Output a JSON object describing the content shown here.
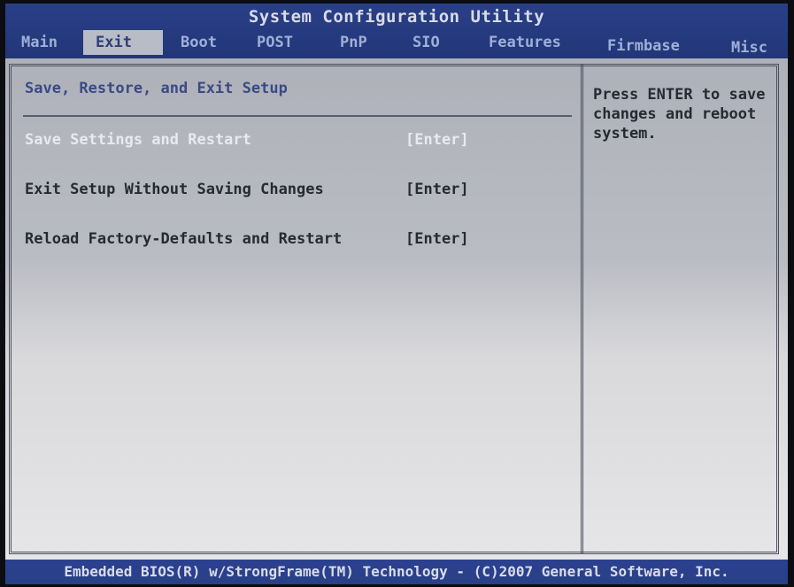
{
  "app": {
    "title": "System Configuration Utility"
  },
  "tabs": [
    {
      "label": "Main"
    },
    {
      "label": "Exit",
      "active": true
    },
    {
      "label": "Boot"
    },
    {
      "label": "POST"
    },
    {
      "label": "PnP"
    },
    {
      "label": "SIO"
    },
    {
      "label": "Features"
    },
    {
      "label": "Firmbase"
    },
    {
      "label": "Misc"
    }
  ],
  "main": {
    "section_title": "Save, Restore, and Exit Setup",
    "items": [
      {
        "label": "Save Settings and Restart",
        "key": "[Enter]",
        "selected": true
      },
      {
        "label": "Exit Setup Without Saving Changes",
        "key": "[Enter]"
      },
      {
        "label": "Reload Factory-Defaults and Restart",
        "key": "[Enter]"
      }
    ]
  },
  "help": {
    "text": "Press ENTER to save changes and reboot system."
  },
  "footer": {
    "text": "Embedded BIOS(R) w/StrongFrame(TM) Technology - (C)2007 General Software, Inc."
  },
  "colors": {
    "header_blue": "#2a3f86",
    "panel_gray": "#babcc3",
    "active_tab_bg": "#b8bcc6",
    "section_title": "#3b4a86",
    "selected_text": "#e9eaf0"
  }
}
